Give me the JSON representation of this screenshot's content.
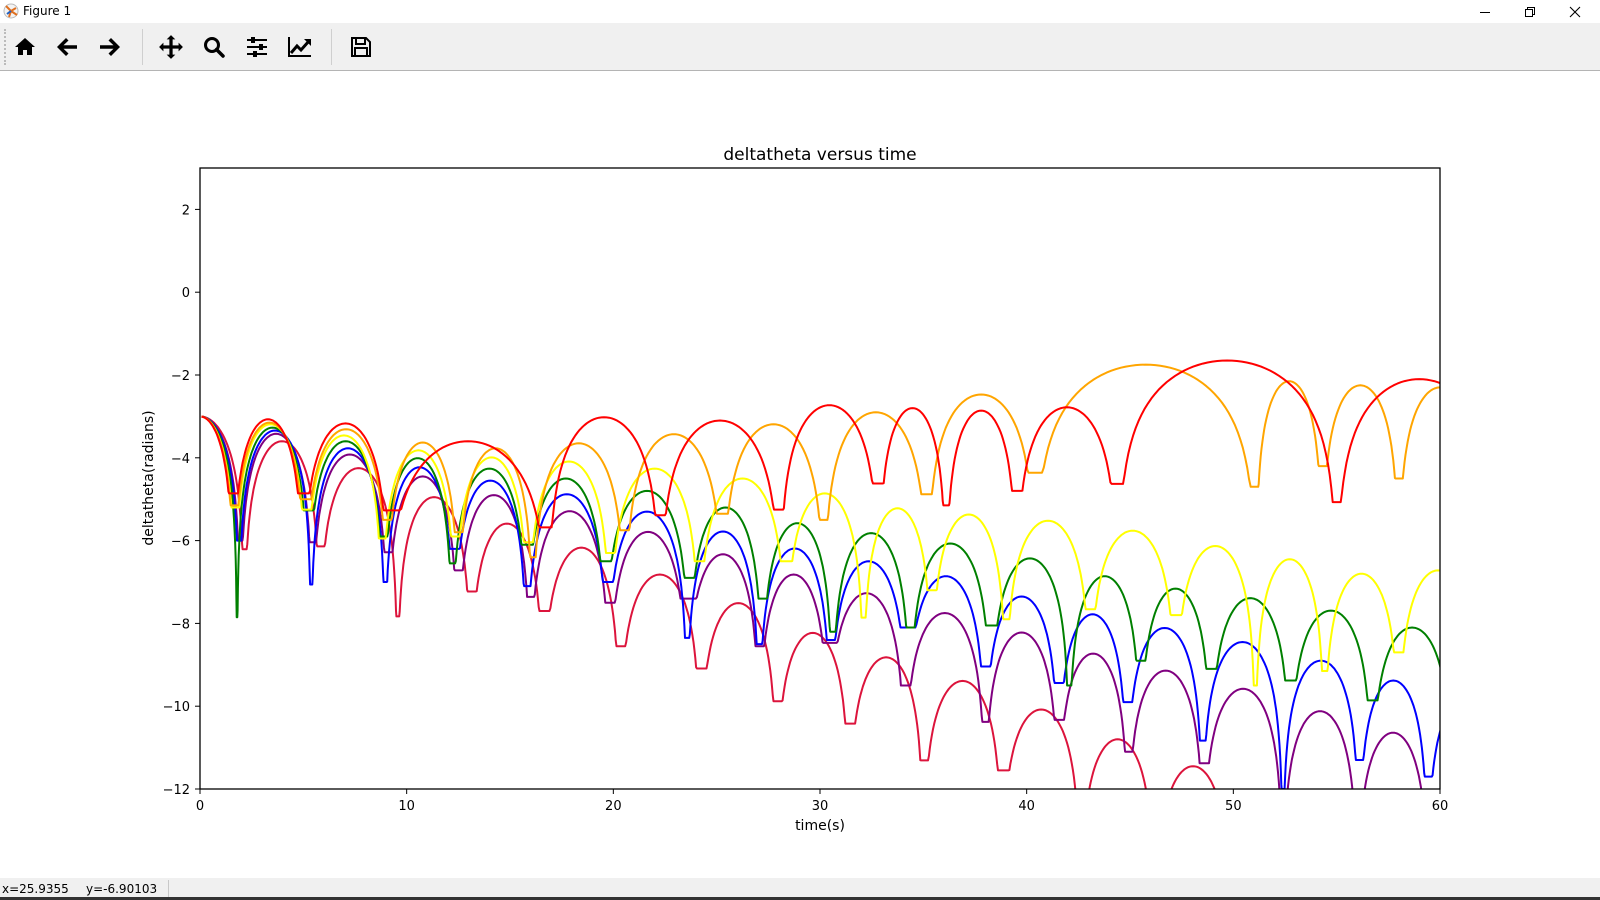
{
  "window": {
    "title": "Figure 1",
    "controls": {
      "minimize": "minimize-icon",
      "restore": "restore-icon",
      "close": "close-icon"
    }
  },
  "toolbar": {
    "buttons": [
      {
        "id": "home",
        "icon": "home-icon"
      },
      {
        "id": "back",
        "icon": "arrow-left-icon"
      },
      {
        "id": "forward",
        "icon": "arrow-right-icon"
      },
      {
        "id": "pan",
        "icon": "move-icon"
      },
      {
        "id": "zoom",
        "icon": "magnifier-icon"
      },
      {
        "id": "subplots",
        "icon": "sliders-icon"
      },
      {
        "id": "edit-axis",
        "icon": "line-chart-icon"
      },
      {
        "id": "save",
        "icon": "floppy-disk-icon"
      }
    ]
  },
  "status": {
    "x": "x=25.9355",
    "y": "y=-6.90103"
  },
  "chart_data": {
    "type": "line",
    "title": "deltatheta versus time",
    "xlabel": "time(s)",
    "ylabel": "deltatheta(radians)",
    "xlim": [
      0,
      60
    ],
    "ylim": [
      -12,
      3
    ],
    "xticks": [
      0,
      10,
      20,
      30,
      40,
      50,
      60
    ],
    "xtick_labels": [
      "0",
      "10",
      "20",
      "30",
      "40",
      "50",
      "60"
    ],
    "yticks": [
      -12,
      -10,
      -8,
      -6,
      -4,
      -2,
      0,
      2
    ],
    "ytick_labels": [
      "−12",
      "−10",
      "−8",
      "−6",
      "−4",
      "−2",
      "0",
      "2"
    ],
    "grid": false,
    "legend": "none",
    "start_value": -3,
    "series_note": "each series: arcs between cusp times; peaks = arc maxima; depths = cusp minima",
    "series": [
      {
        "name": "crimson",
        "color": "#DC143C",
        "cusps": [
          2.14,
          5.79,
          9.55,
          13.1,
          16.6,
          20.3,
          24.2,
          27.9,
          31.4,
          35.0,
          38.8,
          42.6,
          46.2,
          49.9
        ],
        "peaks": [
          -3.6,
          -4.25,
          -4.95,
          -5.59,
          -6.17,
          -6.82,
          -7.51,
          -8.23,
          -8.82,
          -9.39,
          -10.08,
          -10.8,
          -11.45
        ],
        "depths": [
          -6.21,
          -6.14,
          -7.83,
          -7.23,
          -7.7,
          -8.55,
          -9.09,
          -9.88,
          -10.42,
          -11.31,
          -11.55,
          -12.5,
          -12.5,
          -12.5
        ]
      },
      {
        "name": "purple",
        "color": "#800080",
        "cusps": [
          1.94,
          5.42,
          9.08,
          12.47,
          15.97,
          19.8,
          23.56,
          27.05,
          30.4,
          34.1,
          37.98,
          41.53,
          44.9,
          48.55,
          52.39,
          56.0,
          59.45,
          62.9
        ],
        "peaks": [
          -3.42,
          -3.92,
          -4.45,
          -4.9,
          -5.29,
          -5.79,
          -6.33,
          -6.82,
          -7.27,
          -7.75,
          -8.22,
          -8.73,
          -9.14,
          -9.58,
          -10.12,
          -10.64,
          -11.15
        ],
        "depths": [
          -6.0,
          -6.04,
          -6.28,
          -6.72,
          -7.36,
          -7.5,
          -7.4,
          -8.55,
          -8.47,
          -9.5,
          -10.38,
          -10.33,
          -11.1,
          -11.38,
          -12.5,
          -12.5,
          -12.5,
          -12.5
        ]
      },
      {
        "name": "blue",
        "color": "#0000FF",
        "cusps": [
          1.88,
          5.37,
          8.95,
          12.29,
          15.8,
          19.7,
          23.56,
          27.05,
          30.5,
          34.2,
          37.98,
          41.53,
          44.85,
          48.5,
          52.39,
          56.08,
          59.4,
          62.8
        ],
        "peaks": [
          -3.34,
          -3.77,
          -4.23,
          -4.55,
          -4.88,
          -5.3,
          -5.78,
          -6.19,
          -6.5,
          -6.86,
          -7.35,
          -7.78,
          -8.11,
          -8.45,
          -8.9,
          -9.38,
          -9.85
        ],
        "depths": [
          -6.0,
          -7.06,
          -7.0,
          -6.2,
          -7.1,
          -7.0,
          -8.35,
          -8.5,
          -8.4,
          -8.1,
          -9.04,
          -9.44,
          -9.9,
          -10.83,
          -12.0,
          -11.3,
          -11.7,
          -12.0
        ]
      },
      {
        "name": "green",
        "color": "#008000",
        "cusps": [
          1.79,
          5.23,
          8.86,
          12.2,
          15.8,
          19.6,
          23.66,
          27.2,
          30.6,
          34.35,
          38.26,
          42.05,
          45.5,
          48.9,
          52.74,
          56.7,
          60.6
        ],
        "peaks": [
          -3.27,
          -3.6,
          -4.01,
          -4.26,
          -4.5,
          -4.8,
          -5.2,
          -5.58,
          -5.82,
          -6.07,
          -6.43,
          -6.86,
          -7.16,
          -7.39,
          -7.69,
          -8.1
        ],
        "depths": [
          -7.85,
          -5.27,
          -5.9,
          -6.55,
          -6.1,
          -6.5,
          -6.9,
          -7.4,
          -8.2,
          -8.1,
          -8.05,
          -9.5,
          -8.9,
          -9.1,
          -9.38,
          -9.86,
          -10.0
        ]
      },
      {
        "name": "yellow",
        "color": "#FFFF00",
        "cusps": [
          1.69,
          5.13,
          8.8,
          12.34,
          15.87,
          19.84,
          24.15,
          28.35,
          32.1,
          35.4,
          39.0,
          43.06,
          47.2,
          51.06,
          54.4,
          58.0,
          61.8
        ],
        "peaks": [
          -3.19,
          -3.46,
          -3.82,
          -3.99,
          -4.09,
          -4.26,
          -4.5,
          -4.86,
          -5.22,
          -5.37,
          -5.52,
          -5.76,
          -6.13,
          -6.45,
          -6.8,
          -6.72
        ],
        "depths": [
          -5.2,
          -5.25,
          -5.95,
          -5.9,
          -6.04,
          -6.3,
          -6.5,
          -6.5,
          -7.86,
          -7.2,
          -7.9,
          -7.66,
          -7.8,
          -9.5,
          -9.15,
          -8.7,
          -9.0
        ]
      },
      {
        "name": "orange",
        "color": "#FFA500",
        "cusps": [
          1.65,
          5.08,
          9.05,
          12.5,
          16.1,
          20.56,
          25.3,
          30.2,
          35.2,
          40.4,
          51.1,
          54.3,
          58.0,
          62.0
        ],
        "peaks": [
          -3.15,
          -3.31,
          -3.63,
          -3.77,
          -3.65,
          -3.43,
          -3.19,
          -2.9,
          -2.47,
          -1.75,
          -2.15,
          -2.25,
          -2.3
        ],
        "depths": [
          -5.15,
          -5.0,
          -5.5,
          -5.8,
          -6.4,
          -5.75,
          -5.35,
          -5.5,
          -4.88,
          -4.36,
          -4.7,
          -4.2,
          -4.5,
          -4.5
        ]
      },
      {
        "name": "red",
        "color": "#FF0000",
        "cusps": [
          1.6,
          4.98,
          9.1,
          16.84,
          22.26,
          28.06,
          32.85,
          36.1,
          39.5,
          44.4,
          55.0,
          63.0
        ],
        "peaks": [
          -3.07,
          -3.17,
          -3.6,
          -3.02,
          -3.1,
          -2.73,
          -2.8,
          -2.86,
          -2.78,
          -1.65,
          -2.1
        ],
        "depths": [
          -4.86,
          -4.86,
          -5.27,
          -5.68,
          -5.39,
          -5.25,
          -4.62,
          -5.15,
          -4.8,
          -4.63,
          -5.07,
          -5.0
        ]
      }
    ]
  }
}
